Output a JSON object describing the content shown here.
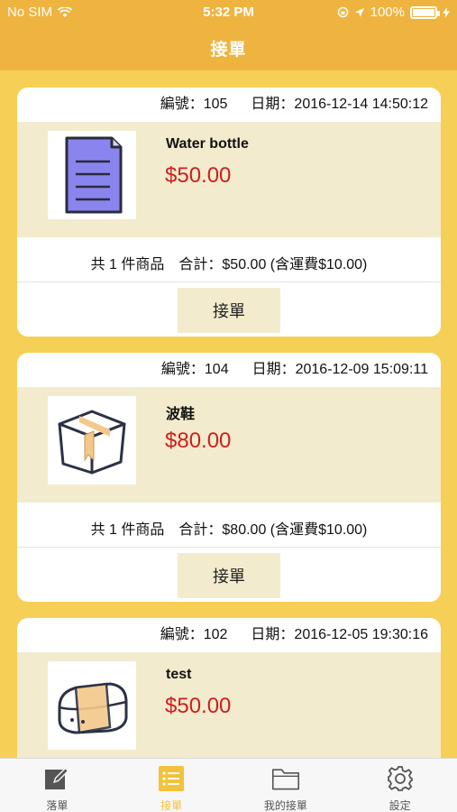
{
  "status_bar": {
    "carrier": "No SIM",
    "time": "5:32 PM",
    "battery": "100%"
  },
  "header": {
    "title": "接單"
  },
  "orders": [
    {
      "number_label": "編號：105",
      "date_label": "日期：2016-12-14 14:50:12",
      "product_name": "Water bottle",
      "price": "$50.00",
      "thumbnail_icon": "document-icon",
      "item_count_label": "共 1 件商品",
      "total_label": "合計：$50.00 (含運費$10.00)",
      "button_label": "接單"
    },
    {
      "number_label": "編號：104",
      "date_label": "日期：2016-12-09 15:09:11",
      "product_name": "波鞋",
      "price": "$80.00",
      "thumbnail_icon": "box-icon",
      "item_count_label": "共 1 件商品",
      "total_label": "合計：$80.00 (含運費$10.00)",
      "button_label": "接單"
    },
    {
      "number_label": "編號：102",
      "date_label": "日期：2016-12-05 19:30:16",
      "product_name": "test",
      "price": "$50.00",
      "thumbnail_icon": "sushi-icon",
      "item_count_label": "",
      "total_label": "",
      "button_label": ""
    }
  ],
  "tabbar": {
    "items": [
      {
        "label": "落單",
        "icon": "pencil-icon"
      },
      {
        "label": "接單",
        "icon": "list-icon"
      },
      {
        "label": "我的接單",
        "icon": "folder-icon"
      },
      {
        "label": "設定",
        "icon": "gear-icon"
      }
    ],
    "active_color": "#f1c23b"
  },
  "colors": {
    "header_bg": "#efb43f",
    "page_bg": "#f6cf57",
    "card_body_bg": "#f3ebcd",
    "price": "#cc1f1f"
  }
}
